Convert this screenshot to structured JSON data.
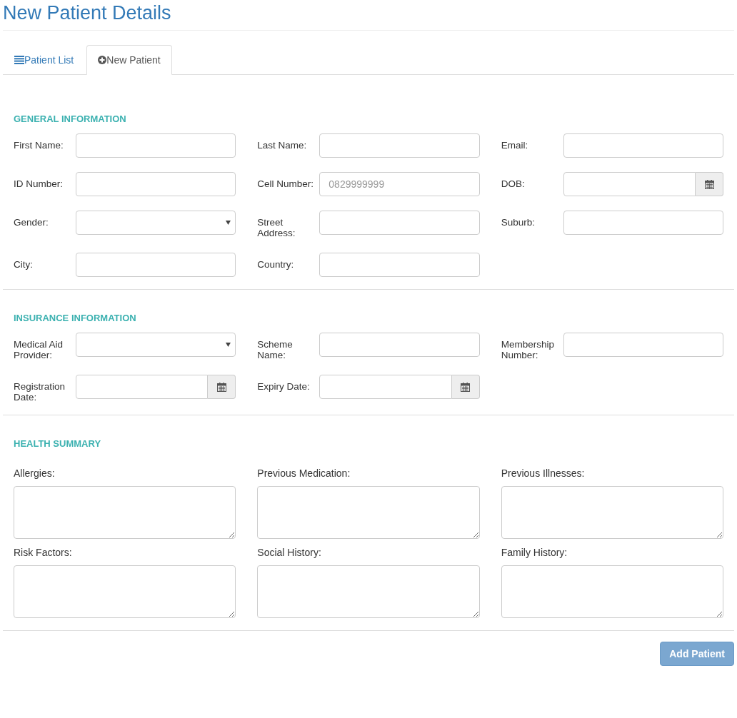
{
  "title": "New Patient Details",
  "tabs": [
    {
      "label": "Patient List",
      "kind": "list",
      "selected": false
    },
    {
      "label": "New Patient",
      "kind": "plus",
      "selected": true
    }
  ],
  "sections": [
    {
      "heading": "GENERAL INFORMATION",
      "kind": "inline",
      "fields": [
        {
          "label": "First Name:",
          "kind": "text"
        },
        {
          "label": "Last Name:",
          "kind": "text"
        },
        {
          "label": "Email:",
          "kind": "text"
        },
        {
          "label": "ID Number:",
          "kind": "text"
        },
        {
          "label": "Cell Number:",
          "kind": "text",
          "placeholder": "0829999999"
        },
        {
          "label": "DOB:",
          "kind": "date"
        },
        {
          "label": "Gender:",
          "kind": "select"
        },
        {
          "label": "Street Address:",
          "kind": "text"
        },
        {
          "label": "Suburb:",
          "kind": "text"
        },
        {
          "label": "City:",
          "kind": "text"
        },
        {
          "label": "Country:",
          "kind": "text"
        }
      ]
    },
    {
      "heading": "INSURANCE INFORMATION",
      "kind": "inline",
      "fields": [
        {
          "label": "Medical Aid Provider:",
          "kind": "select"
        },
        {
          "label": "Scheme Name:",
          "kind": "text"
        },
        {
          "label": "Membership Number:",
          "kind": "text"
        },
        {
          "label": "Registration Date:",
          "kind": "date"
        },
        {
          "label": "Expiry Date:",
          "kind": "date"
        }
      ]
    },
    {
      "heading": "HEALTH SUMMARY",
      "kind": "stacked",
      "fields": [
        {
          "label": "Allergies:",
          "kind": "textarea"
        },
        {
          "label": "Previous Medication:",
          "kind": "textarea"
        },
        {
          "label": "Previous Illnesses:",
          "kind": "textarea"
        },
        {
          "label": "Risk Factors:",
          "kind": "textarea"
        },
        {
          "label": "Social History:",
          "kind": "textarea"
        },
        {
          "label": "Family History:",
          "kind": "textarea"
        }
      ]
    }
  ],
  "submit": {
    "label": "Add Patient",
    "disabled": true
  }
}
